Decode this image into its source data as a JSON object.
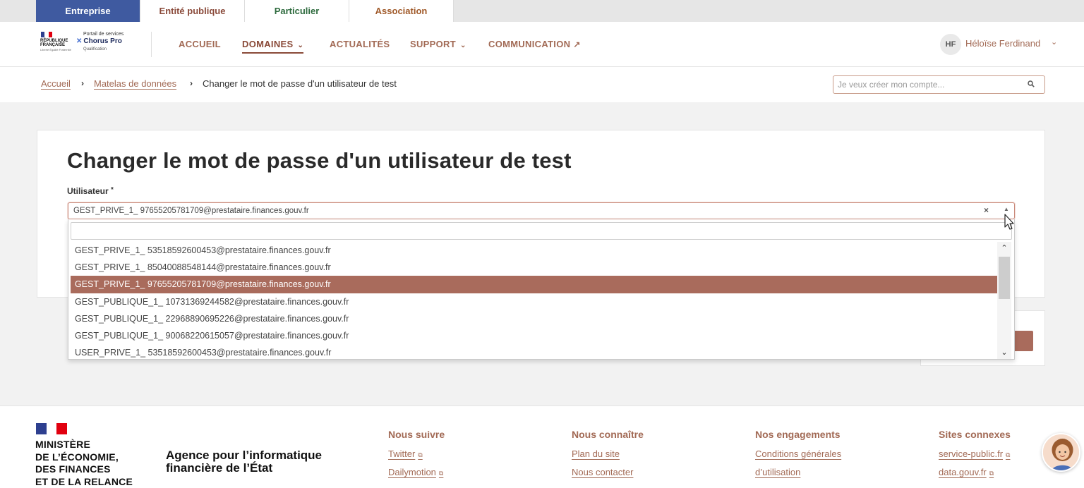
{
  "audience_tabs": [
    "Entreprise",
    "Entité publique",
    "Particulier",
    "Association"
  ],
  "logo": {
    "rf_text": "RÉPUBLIQUE FRANÇAISE",
    "motto": "Liberté Égalité Fraternité",
    "portal": "Portail de services",
    "app_name": "Chorus Pro",
    "env": "Qualification"
  },
  "nav": {
    "accueil": "ACCUEIL",
    "domaines": "DOMAINES",
    "actualites": "ACTUALITÉS",
    "support": "SUPPORT",
    "communication": "COMMUNICATION"
  },
  "user": {
    "initials": "HF",
    "name": "Héloïse Ferdinand"
  },
  "breadcrumb": {
    "home": "Accueil",
    "parent": "Matelas de données",
    "current": "Changer le mot de passe d'un utilisateur de test"
  },
  "search": {
    "placeholder": "Je veux créer mon compte..."
  },
  "page": {
    "title": "Changer le mot de passe d'un utilisateur de test",
    "field_label": "Utilisateur",
    "required_mark": "*"
  },
  "select": {
    "value": "GEST_PRIVE_1_ 97655205781709@prestataire.finances.gouv.fr",
    "clear": "×",
    "arrow": "▲",
    "options": [
      "GEST_PRIVE_1_ 53518592600453@prestataire.finances.gouv.fr",
      "GEST_PRIVE_1_ 85040088548144@prestataire.finances.gouv.fr",
      "GEST_PRIVE_1_ 97655205781709@prestataire.finances.gouv.fr",
      "GEST_PUBLIQUE_1_ 10731369244582@prestataire.finances.gouv.fr",
      "GEST_PUBLIQUE_1_ 22968890695226@prestataire.finances.gouv.fr",
      "GEST_PUBLIQUE_1_ 90068220615057@prestataire.finances.gouv.fr",
      "USER_PRIVE_1_ 53518592600453@prestataire.finances.gouv.fr"
    ],
    "selected_index": 2
  },
  "colors": {
    "accent": "#a96b5c",
    "primary_blue": "#3f5aa0",
    "link": "#a26a55"
  },
  "footer": {
    "ministry_lines": [
      "MINISTÈRE",
      "DE L’ÉCONOMIE,",
      "DES FINANCES",
      "ET DE LA RELANCE"
    ],
    "agency_lines": [
      "Agence pour l’informatique",
      "financière de l’État"
    ],
    "columns": [
      {
        "title": "Nous suivre",
        "links": [
          "Twitter",
          "Dailymotion"
        ]
      },
      {
        "title": "Nous connaître",
        "links": [
          "Plan du site",
          "Nous contacter"
        ]
      },
      {
        "title": "Nos engagements",
        "links": [
          "Conditions générales",
          "d’utilisation"
        ]
      },
      {
        "title": "Sites connexes",
        "links": [
          "service-public.fr",
          "data.gouv.fr"
        ]
      }
    ]
  },
  "icons": {
    "search": "search-icon",
    "external": "external-link-icon",
    "chevron": "chevron-down-icon"
  }
}
